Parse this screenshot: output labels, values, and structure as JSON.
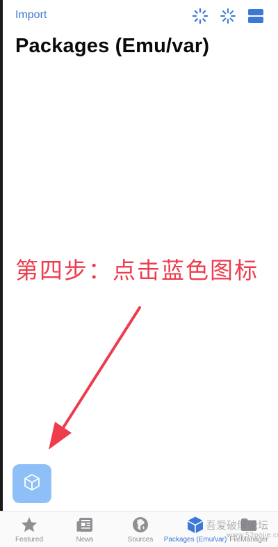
{
  "nav": {
    "import_label": "Import",
    "icons": [
      "spinner-icon",
      "sparkle-loading-icon",
      "list-layout-icon"
    ]
  },
  "page": {
    "title": "Packages (Emu/var)"
  },
  "annotation": {
    "text": "第四步：点击蓝色图标",
    "color": "#ee3c4d"
  },
  "fab": {
    "icon": "package-box-icon",
    "color": "#8ec0f7"
  },
  "tabs": [
    {
      "label": "Featured",
      "icon": "star-icon",
      "active": false
    },
    {
      "label": "News",
      "icon": "newspaper-icon",
      "active": false
    },
    {
      "label": "Sources",
      "icon": "globe-icon",
      "active": false
    },
    {
      "label": "Packages (Emu/var)",
      "icon": "package-box-icon",
      "active": true
    },
    {
      "label": "FileManager",
      "icon": "folder-icon",
      "active": false
    }
  ],
  "watermark": {
    "text": "吾爱破解论坛",
    "sub": "www.52pojie.cn"
  },
  "colors": {
    "accent": "#3b78d8",
    "inactive": "#8e8e93"
  }
}
